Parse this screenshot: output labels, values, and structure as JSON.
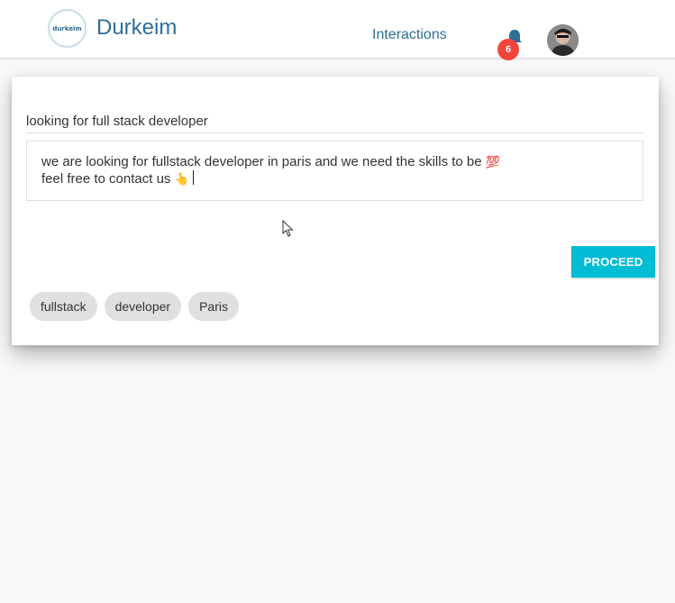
{
  "header": {
    "logo_text": "durkeim",
    "brand": "Durkeim",
    "nav_link": "Interactions",
    "notification_count": "6",
    "icons": [
      "bell-icon",
      "avatar"
    ]
  },
  "post": {
    "title_value": "looking for full stack developer",
    "body_line1": "we are looking for fullstack developer in paris and we need the skills to be",
    "body_line1_emoji": "💯",
    "body_line2": "feel free to contact us",
    "body_line2_emoji": "👆",
    "proceed_label": "PROCEED",
    "tags": [
      "fullstack",
      "developer",
      "Paris"
    ]
  },
  "colors": {
    "brand": "#2d6f99",
    "accent": "#00bcd4",
    "badge": "#f4433a",
    "chip": "#e0e0e0"
  }
}
